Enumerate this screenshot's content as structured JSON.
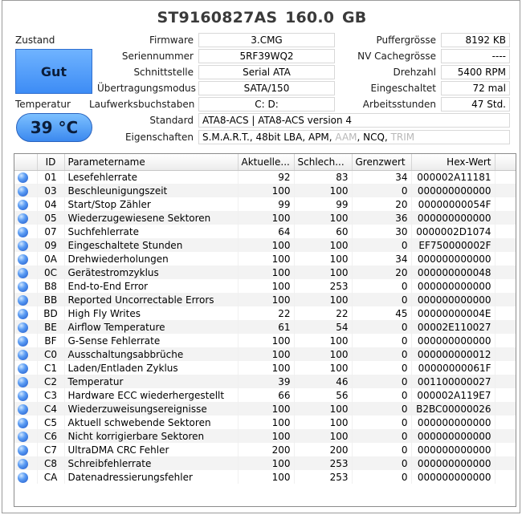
{
  "disk": {
    "title": "ST9160827AS  160.0 GB"
  },
  "status": {
    "label": "Zustand",
    "value": "Gut",
    "color": "#4a96f7"
  },
  "temperature": {
    "label": "Temperatur",
    "value": "39 °C"
  },
  "info_left": [
    {
      "label": "Firmware",
      "value": "3.CMG"
    },
    {
      "label": "Seriennummer",
      "value": "5RF39WQ2"
    },
    {
      "label": "Schnittstelle",
      "value": "Serial ATA"
    },
    {
      "label": "Übertragungsmodus",
      "value": "SATA/150"
    },
    {
      "label": "Laufwerksbuchstaben",
      "value": "C: D:"
    }
  ],
  "info_right": [
    {
      "label": "Puffergrösse",
      "value": "8192 KB"
    },
    {
      "label": "NV Cachegrösse",
      "value": "----"
    },
    {
      "label": "Drehzahl",
      "value": "5400 RPM"
    },
    {
      "label": "Eingeschaltet",
      "value": "72 mal"
    },
    {
      "label": "Arbeitsstunden",
      "value": "47 Std."
    }
  ],
  "standard": {
    "label": "Standard",
    "value": "ATA8-ACS | ATA8-ACS version 4"
  },
  "features": {
    "label": "Eigenschaften",
    "active": "S.M.A.R.T., 48bit LBA, APM, ",
    "aam": "AAM",
    "sep": ", NCQ, ",
    "trim": "TRIM"
  },
  "table": {
    "headers": [
      "",
      "ID",
      "Parametername",
      "Aktuelle...",
      "Schlech...",
      "Grenzwert",
      "Hex-Wert"
    ],
    "rows": [
      [
        "01",
        "Lesefehlerrate",
        "92",
        "83",
        "34",
        "000002A11181"
      ],
      [
        "03",
        "Beschleunigungszeit",
        "100",
        "100",
        "0",
        "000000000000"
      ],
      [
        "04",
        "Start/Stop Zähler",
        "99",
        "99",
        "20",
        "00000000054F"
      ],
      [
        "05",
        "Wiederzugewiesene Sektoren",
        "100",
        "100",
        "36",
        "000000000000"
      ],
      [
        "07",
        "Suchfehlerrate",
        "64",
        "60",
        "30",
        "0000002D1074"
      ],
      [
        "09",
        "Eingeschaltete Stunden",
        "100",
        "100",
        "0",
        "EF750000002F"
      ],
      [
        "0A",
        "Drehwiederholungen",
        "100",
        "100",
        "34",
        "000000000000"
      ],
      [
        "0C",
        "Gerätestromzyklus",
        "100",
        "100",
        "20",
        "000000000048"
      ],
      [
        "B8",
        "End-to-End Error",
        "100",
        "253",
        "0",
        "000000000000"
      ],
      [
        "BB",
        "Reported Uncorrectable Errors",
        "100",
        "100",
        "0",
        "000000000000"
      ],
      [
        "BD",
        "High Fly Writes",
        "22",
        "22",
        "45",
        "00000000004E"
      ],
      [
        "BE",
        "Airflow Temperature",
        "61",
        "54",
        "0",
        "00002E110027"
      ],
      [
        "BF",
        "G-Sense Fehlerrate",
        "100",
        "100",
        "0",
        "000000000000"
      ],
      [
        "C0",
        "Ausschaltungsabbrüche",
        "100",
        "100",
        "0",
        "000000000012"
      ],
      [
        "C1",
        "Laden/Entladen Zyklus",
        "100",
        "100",
        "0",
        "00000000061F"
      ],
      [
        "C2",
        "Temperatur",
        "39",
        "46",
        "0",
        "001100000027"
      ],
      [
        "C3",
        "Hardware ECC wiederhergestellt",
        "66",
        "56",
        "0",
        "000002A119E7"
      ],
      [
        "C4",
        "Wiederzuweisungsereignisse",
        "100",
        "100",
        "0",
        "B2BC00000026"
      ],
      [
        "C5",
        "Aktuell schwebende Sektoren",
        "100",
        "100",
        "0",
        "000000000000"
      ],
      [
        "C6",
        "Nicht korrigierbare Sektoren",
        "100",
        "100",
        "0",
        "000000000000"
      ],
      [
        "C7",
        "UltraDMA CRC Fehler",
        "200",
        "200",
        "0",
        "000000000000"
      ],
      [
        "C8",
        "Schreibfehlerrate",
        "100",
        "253",
        "0",
        "000000000000"
      ],
      [
        "CA",
        "Datenadressierungsfehler",
        "100",
        "253",
        "0",
        "000000000000"
      ]
    ]
  }
}
